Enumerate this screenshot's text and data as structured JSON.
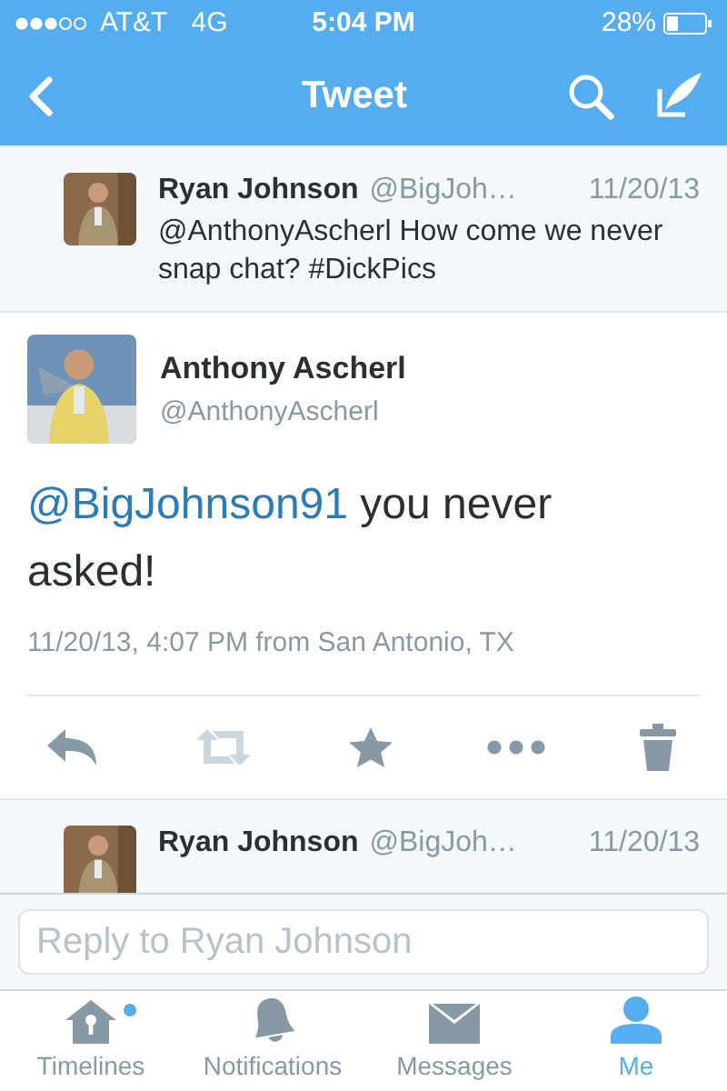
{
  "status_bar": {
    "carrier": "AT&T",
    "network": "4G",
    "time": "5:04 PM",
    "battery": "28%"
  },
  "nav": {
    "title": "Tweet"
  },
  "tweets": [
    {
      "kind": "compact",
      "name": "Ryan Johnson",
      "handle": "@BigJoh…",
      "date": "11/20/13",
      "text": "@AnthonyAscherl How come we never snap chat? #DickPics"
    },
    {
      "kind": "main",
      "name": "Anthony Ascherl",
      "handle": "@AnthonyAscherl",
      "mention": "@BigJohnson91",
      "text": "you never asked!",
      "meta": "11/20/13, 4:07 PM from San Antonio, TX",
      "actions": [
        {
          "kind": "reply",
          "disabled": false
        },
        {
          "kind": "retweet",
          "disabled": true
        },
        {
          "kind": "favorite",
          "disabled": false
        },
        {
          "kind": "more",
          "disabled": false
        },
        {
          "kind": "delete",
          "disabled": false
        }
      ]
    },
    {
      "kind": "compact",
      "name": "Ryan Johnson",
      "handle": "@BigJoh…",
      "date": "11/20/13"
    }
  ],
  "reply": {
    "placeholder": "Reply to Ryan Johnson"
  },
  "tabs": [
    {
      "kind": "timelines",
      "label": "Timelines",
      "selected": false,
      "unread": true
    },
    {
      "kind": "notifications",
      "label": "Notifications",
      "selected": false,
      "unread": false
    },
    {
      "kind": "messages",
      "label": "Messages",
      "selected": false,
      "unread": false
    },
    {
      "kind": "me",
      "label": "Me",
      "selected": true,
      "unread": false
    }
  ]
}
